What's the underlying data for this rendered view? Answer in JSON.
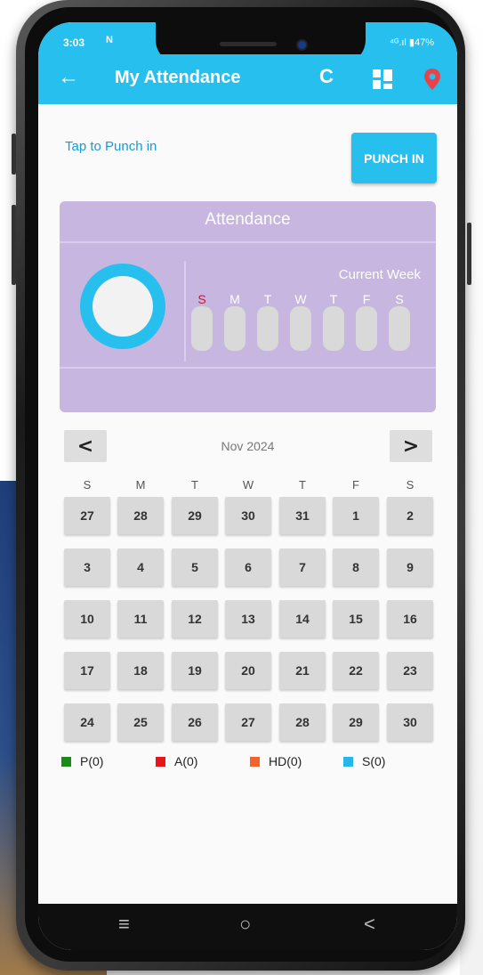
{
  "status_bar": {
    "time": "3:03",
    "notif_icon": "N",
    "right": "⁴ᴳ.ıl ▮47%"
  },
  "app_bar": {
    "title": "My Attendance",
    "back_icon": "←",
    "refresh_icon": "C"
  },
  "punch": {
    "hint": "Tap to Punch in",
    "button_label": "PUNCH IN"
  },
  "attendance_card": {
    "title": "Attendance",
    "week_label": "Current Week",
    "week_days": [
      "S",
      "M",
      "T",
      "W",
      "T",
      "F",
      "S"
    ]
  },
  "calendar": {
    "month": "Nov 2024",
    "prev_label": "<",
    "next_label": ">",
    "day_headers": [
      "S",
      "M",
      "T",
      "W",
      "T",
      "F",
      "S"
    ],
    "weeks": [
      [
        "27",
        "28",
        "29",
        "30",
        "31",
        "1",
        "2"
      ],
      [
        "3",
        "4",
        "5",
        "6",
        "7",
        "8",
        "9"
      ],
      [
        "10",
        "11",
        "12",
        "13",
        "14",
        "15",
        "16"
      ],
      [
        "17",
        "18",
        "19",
        "20",
        "21",
        "22",
        "23"
      ],
      [
        "24",
        "25",
        "26",
        "27",
        "28",
        "29",
        "30"
      ]
    ]
  },
  "legend": [
    {
      "label": "P(0)",
      "color": "#1a8a1a"
    },
    {
      "label": "A(0)",
      "color": "#e8141c"
    },
    {
      "label": "HD(0)",
      "color": "#f2622a"
    },
    {
      "label": "S(0)",
      "color": "#27b6e8"
    }
  ],
  "nav_bar": {
    "menu_icon": "≡",
    "home_icon": "○",
    "back_icon": "<"
  },
  "colors": {
    "accent": "#27c0ee",
    "card": "#c6b6e0",
    "pin": "#e8424a"
  }
}
